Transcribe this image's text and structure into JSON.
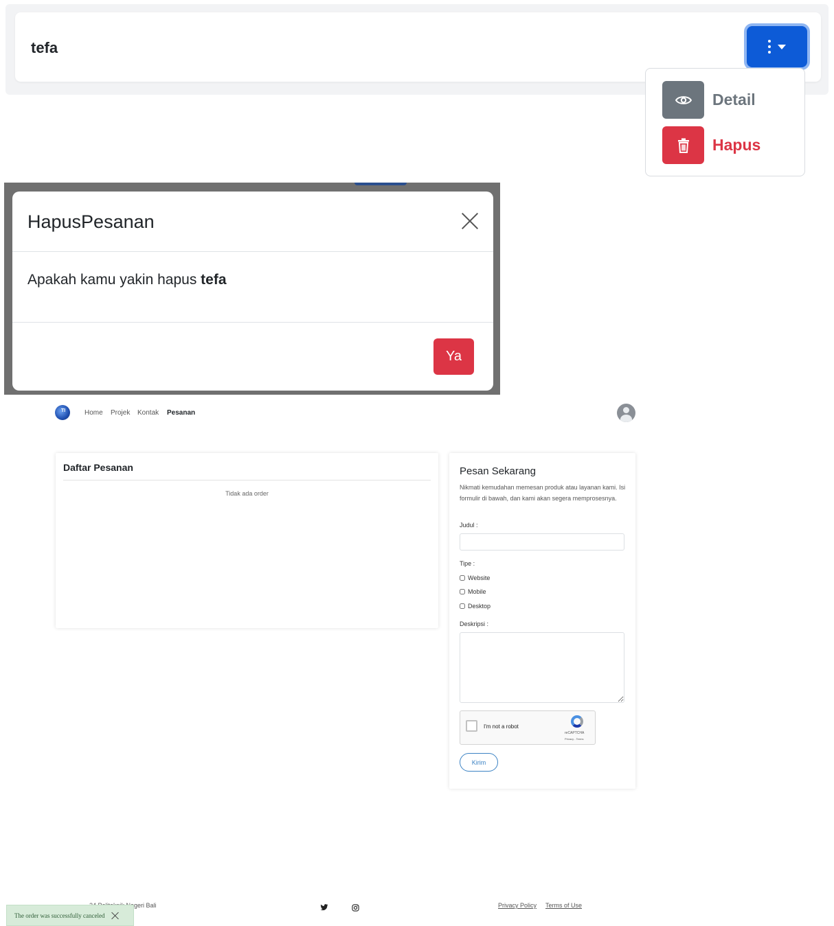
{
  "order_panel": {
    "order_name": "tefa",
    "dropdown": {
      "items": [
        {
          "label": "Detail",
          "icon": "eye-icon",
          "color": "#6c757d"
        },
        {
          "label": "Hapus",
          "icon": "trash-icon",
          "color": "#dc3545"
        }
      ]
    },
    "menu_button_color": "#0d5bd7"
  },
  "delete_modal": {
    "title": "HapusPesanan",
    "body_prefix": "Apakah kamu yakin hapus ",
    "body_target": "tefa",
    "confirm_label": "Ya",
    "confirm_color": "#dc3545"
  },
  "page": {
    "nav": {
      "items": [
        "Home",
        "Projek",
        "Kontak",
        "Pesanan"
      ],
      "active": "Pesanan"
    },
    "orders_list": {
      "title": "Daftar Pesanan",
      "empty_text": "Tidak ada order"
    },
    "order_form": {
      "title": "Pesan Sekarang",
      "description": "Nikmati kemudahan memesan produk atau layanan kami. Isi formulir di bawah, dan kami akan segera memprosesnya.",
      "judul_label": "Judul :",
      "judul_value": "",
      "tipe_label": "Tipe :",
      "tipe_options": [
        "Website",
        "Mobile",
        "Desktop"
      ],
      "deskripsi_label": "Deskripsi :",
      "deskripsi_value": "",
      "recaptcha_label": "I'm not a robot",
      "recaptcha_brand": "reCAPTCHA",
      "recaptcha_links": "Privacy - Terms",
      "submit_label": "Kirim"
    },
    "footer": {
      "copyright_visible": "24 Politeknik Negeri Bali",
      "privacy_label": "Privacy Policy",
      "terms_label": "Terms of Use"
    }
  },
  "toast": {
    "message": "The order was successfully canceled",
    "color": "#d7ebd9"
  }
}
